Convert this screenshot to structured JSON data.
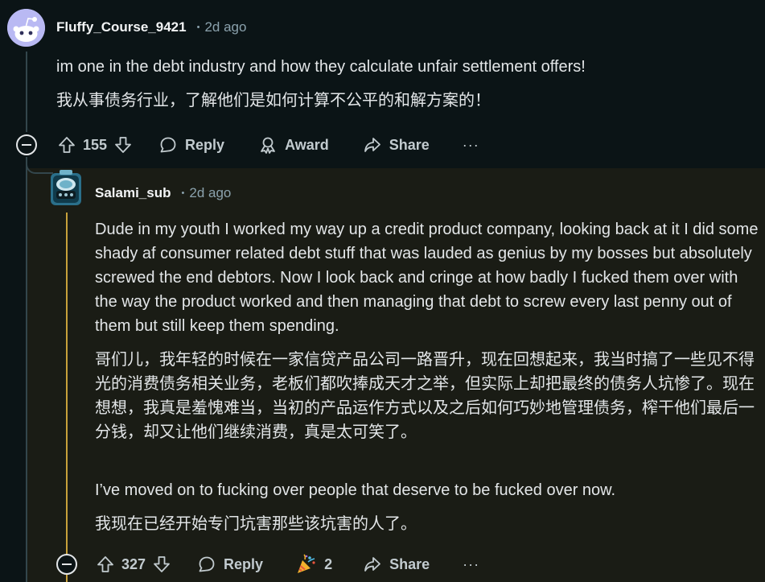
{
  "comment1": {
    "username": "Fluffy_Course_9421",
    "separator": "•",
    "age": "2d ago",
    "body_en": "im one in the debt industry and how they calculate unfair settlement offers!",
    "body_zh": "我从事债务行业，了解他们是如何计算不公平的和解方案的！",
    "votes": "155",
    "reply_label": "Reply",
    "award_label": "Award",
    "share_label": "Share",
    "more_label": "···"
  },
  "comment2": {
    "username": "Salami_sub",
    "separator": "•",
    "age": "2d ago",
    "body_en_1": "Dude in my youth I worked my way up a credit product company, looking back at it I did some shady af consumer related debt stuff that was lauded as genius by my bosses but absolutely screwed the end debtors. Now I look back and cringe at how badly I fucked them over with the way the product worked and then managing that debt to screw every last penny out of them but still keep them spending.",
    "body_zh_1": "哥们儿，我年轻的时候在一家信贷产品公司一路晋升，现在回想起来，我当时搞了一些见不得光的消费债务相关业务，老板们都吹捧成天才之举，但实际上却把最终的债务人坑惨了。现在想想，我真是羞愧难当，当初的产品运作方式以及之后如何巧妙地管理债务，榨干他们最后一分钱，却又让他们继续消费，真是太可笑了。",
    "body_en_2": "I’ve moved on to fucking over people that deserve to be fucked over now.",
    "body_zh_2": "我现在已经开始专门坑害那些该坑害的人了。",
    "votes": "327",
    "reply_label": "Reply",
    "award_count": "2",
    "share_label": "Share",
    "more_label": "···"
  },
  "icons": {
    "collapse": "minus-circle-icon",
    "upvote": "arrow-up-icon",
    "downvote": "arrow-down-icon",
    "reply": "speech-bubble-icon",
    "award": "award-ribbon-icon",
    "share": "share-arrow-icon",
    "celebrate": "party-popper-icon"
  },
  "colors": {
    "background": "#0b1416",
    "nested_background": "#1a1c15",
    "thread_highlight": "#c8a13a",
    "text": "#e3e6e8",
    "muted": "#8ba2ad"
  }
}
